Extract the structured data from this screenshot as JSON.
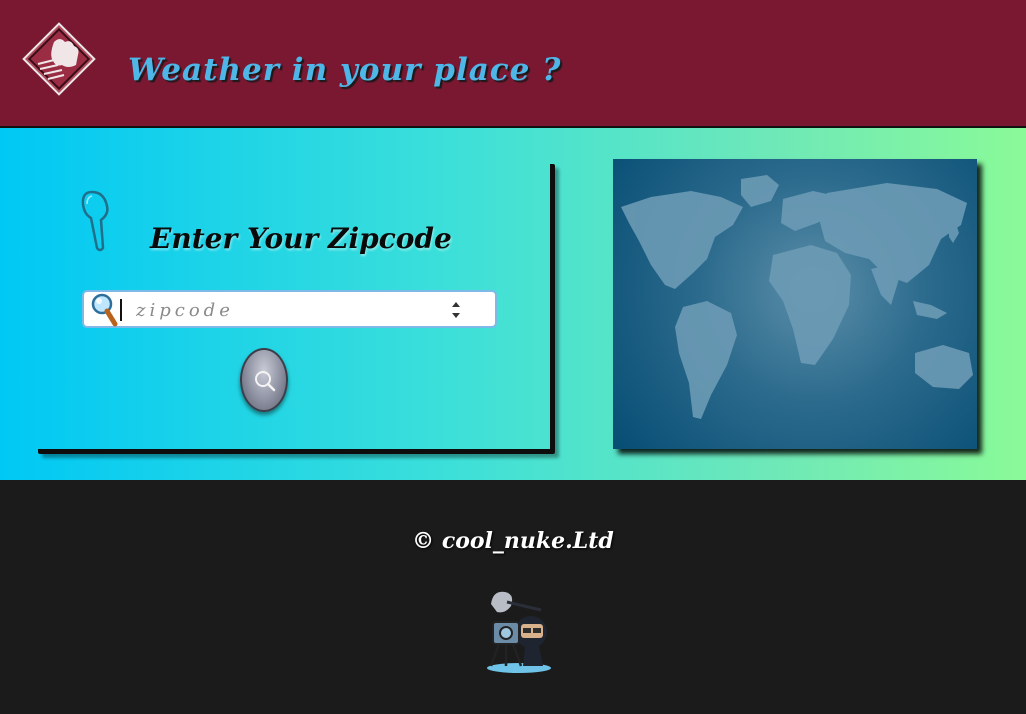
{
  "header": {
    "title": "Weather in your place ?",
    "logo_icon": "cloud-rain-diamond-icon"
  },
  "zip_card": {
    "heading": "Enter Your Zipcode",
    "pin_icon": "paperclip-pin-icon",
    "search_field": {
      "placeholder": "zipcode",
      "value": "",
      "icon": "magnifier-icon"
    },
    "search_button_icon": "search-icon"
  },
  "map": {
    "icon": "world-map"
  },
  "footer": {
    "copyright": "© cool_nuke.Ltd",
    "mascot_icon": "cameraman-mascot-icon"
  },
  "colors": {
    "header_bg": "#7a1832",
    "title": "#4fb6e8",
    "gradient_start": "#00c8f5",
    "gradient_end": "#8afa98",
    "footer_bg": "#1b1b1b",
    "map_bg": "#064d74"
  }
}
